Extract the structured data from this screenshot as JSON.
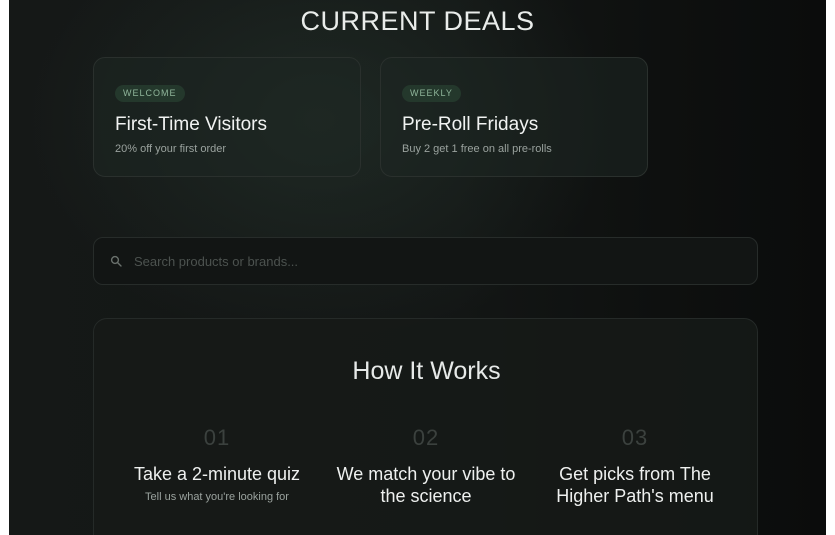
{
  "deals": {
    "heading": "CURRENT DEALS",
    "items": [
      {
        "badge": "WELCOME",
        "title": "First-Time Visitors",
        "description": "20% off your first order"
      },
      {
        "badge": "WEEKLY",
        "title": "Pre-Roll Fridays",
        "description": "Buy 2 get 1 free on all pre-rolls"
      }
    ]
  },
  "search": {
    "icon": "search-icon",
    "value": "",
    "placeholder": "Search products or brands..."
  },
  "how_it_works": {
    "heading": "How It Works",
    "steps": [
      {
        "number": "01",
        "title": "Take a 2-minute quiz",
        "description": "Tell us what you're looking for"
      },
      {
        "number": "02",
        "title": "We match your vibe to the science",
        "description": ""
      },
      {
        "number": "03",
        "title": "Get picks from The Higher Path's menu",
        "description": ""
      }
    ]
  },
  "colors": {
    "background": "#131615",
    "badge_bg": "#24382c",
    "badge_text": "#8fb59a",
    "muted_text": "#9aa29e"
  }
}
